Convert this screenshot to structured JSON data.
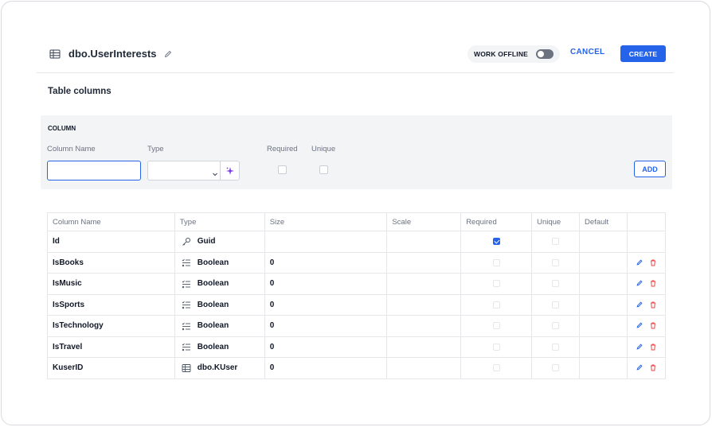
{
  "header": {
    "title": "dbo.UserInterests",
    "work_offline_label": "WORK OFFLINE",
    "cancel_label": "CANCEL",
    "create_label": "CREATE"
  },
  "section_title": "Table columns",
  "column_form": {
    "title": "COLUMN",
    "column_name_label": "Column Name",
    "type_label": "Type",
    "required_label": "Required",
    "unique_label": "Unique",
    "column_name_value": "",
    "type_value": "",
    "add_label": "ADD"
  },
  "table": {
    "headers": [
      "Column Name",
      "Type",
      "Size",
      "Scale",
      "Required",
      "Unique",
      "Default"
    ],
    "rows": [
      {
        "name": "Id",
        "type": "Guid",
        "type_icon": "key-icon",
        "size": "",
        "scale": "",
        "required": true,
        "unique": false,
        "default": "",
        "actions": false
      },
      {
        "name": "IsBooks",
        "type": "Boolean",
        "type_icon": "boolean-list-icon",
        "size": "0",
        "scale": "",
        "required": false,
        "unique": false,
        "default": "",
        "actions": true
      },
      {
        "name": "IsMusic",
        "type": "Boolean",
        "type_icon": "boolean-list-icon",
        "size": "0",
        "scale": "",
        "required": false,
        "unique": false,
        "default": "",
        "actions": true
      },
      {
        "name": "IsSports",
        "type": "Boolean",
        "type_icon": "boolean-list-icon",
        "size": "0",
        "scale": "",
        "required": false,
        "unique": false,
        "default": "",
        "actions": true
      },
      {
        "name": "IsTechnology",
        "type": "Boolean",
        "type_icon": "boolean-list-icon",
        "size": "0",
        "scale": "",
        "required": false,
        "unique": false,
        "default": "",
        "actions": true
      },
      {
        "name": "IsTravel",
        "type": "Boolean",
        "type_icon": "boolean-list-icon",
        "size": "0",
        "scale": "",
        "required": false,
        "unique": false,
        "default": "",
        "actions": true
      },
      {
        "name": "KuserID",
        "type": "dbo.KUser",
        "type_icon": "table-icon",
        "size": "0",
        "scale": "",
        "required": false,
        "unique": false,
        "default": "",
        "actions": true
      }
    ]
  },
  "colors": {
    "accent": "#2563eb",
    "delete": "#ef4444",
    "magic": "#7c3aed",
    "muted_text": "#6b7280",
    "panel_bg": "#f3f4f6"
  }
}
